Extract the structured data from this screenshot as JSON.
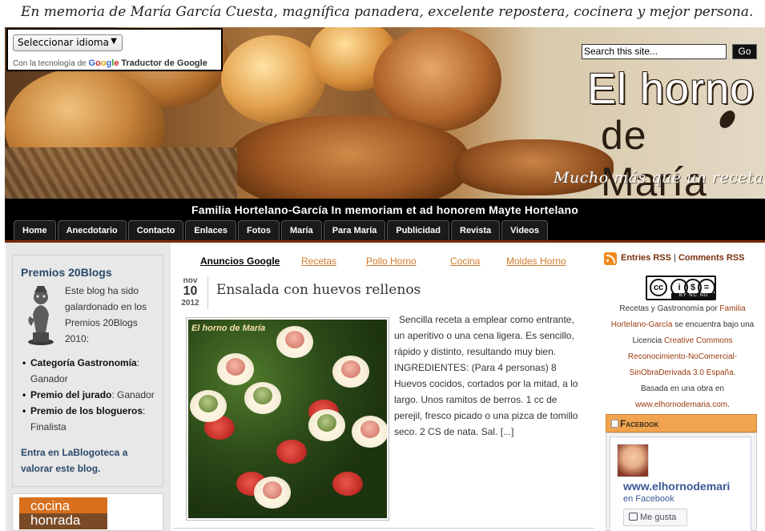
{
  "memorial": "En memoria de María García Cuesta, magnífica panadera, excelente repostera, cocinera y mejor persona.",
  "translate": {
    "select_label": "Seleccionar idioma",
    "powered_prefix": "Con la tecnología de",
    "google": "Google",
    "translator": "Traductor de Google"
  },
  "search": {
    "placeholder": "Search this site...",
    "button": "Go"
  },
  "logo": {
    "line1": "El horno",
    "line2": "de María",
    "tagline": "Mucho más que un recetario"
  },
  "band_title": "Familia Hortelano-García In memoriam et ad honorem Mayte Hortelano",
  "nav": [
    "Home",
    "Anecdotario",
    "Contacto",
    "Enlaces",
    "Fotos",
    "María",
    "Para María",
    "Publicidad",
    "Revista",
    "Videos"
  ],
  "ads": {
    "label": "Anuncios Google",
    "topics": [
      "Recetas",
      "Pollo Horno",
      "Cocina",
      "Moldes Horno"
    ]
  },
  "post": {
    "month": "nov",
    "day": "10",
    "year": "2012",
    "title": "Ensalada con huevos rellenos",
    "image_tag": "El horno de María",
    "excerpt": "Sencilla receta a emplear como entrante, un aperitivo o una cena ligera. Es sencillo, rápido y distinto, resultando muy bien. INGREDIENTES: (Para 4 personas) 8 Huevos cocidos, cortados por la mitad, a lo largo. Unos ramitos de berros. 1 cc de perejil, fresco picado o una pizca de tomillo seco. 2 CS de nata. Sal. [...]"
  },
  "award": {
    "title": "Premios 20Blogs",
    "text": "Este blog ha sido galardonado en los Premios 20Blogs 2010:",
    "items": [
      {
        "name": "Categoría Gastronomía",
        "sep": ": ",
        "result": "Ganador"
      },
      {
        "name": "Premio del jurado",
        "sep": ": ",
        "result": "Ganador"
      },
      {
        "name": "Premio de los blogueros",
        "sep": ": ",
        "result": "Finalista"
      }
    ],
    "link": "Entra en LaBlogoteca a valorar este blog."
  },
  "honrada": {
    "line1": "cocina",
    "line2": "honrada"
  },
  "rss": {
    "entries": "Entries RSS",
    "sep": "|",
    "comments": "Comments RSS"
  },
  "cc": {
    "c1": "cc",
    "c2": "i",
    "c3": "$",
    "c4": "=",
    "label": "BY NC ND"
  },
  "license": {
    "l1": "Recetas y Gastronomía por ",
    "l1o": "Familia",
    "l2o": "Hortelano-García",
    "l2": " se encuentra bajo una",
    "l3": "Licencia ",
    "l3o": "Creative Commons",
    "l4o": "Reconocimiento-NoComercial-",
    "l5o": "SinObraDerivada 3.0 España",
    "l5": ".",
    "l6": "Basada en una obra en",
    "l7o": "www.elhornodemaria.com",
    "l7": "."
  },
  "facebook": {
    "header": "Facebook",
    "name": "www.elhornodemari",
    "sub": "en Facebook",
    "like": "Me gusta"
  },
  "colors": {
    "accent": "#d07a2a",
    "band": "#000000",
    "link_blue": "#2b4a6b"
  }
}
